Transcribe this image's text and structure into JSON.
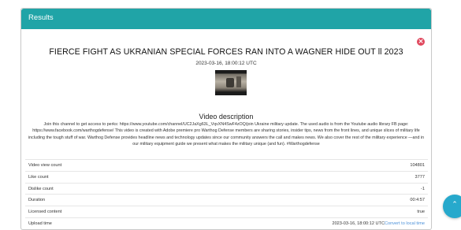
{
  "panel": {
    "header_title": "Results"
  },
  "close_button": {
    "label": "×"
  },
  "video": {
    "title": "FIERCE FIGHT AS UKRANIAN SPECIAL FORCES RAN INTO A WAGNER HIDE OUT ll 2023",
    "date": "2023-03-16, 18:00:12 UTC"
  },
  "description": {
    "heading": "Video description",
    "text": "Join this channel to get access to perks: https://www.youtube.com/channel/UC2JaXg63L_VqvXN4SwF4zOQ/join Ukraine military update. The used audio is from the Youtube audio library FB page: https://www.facebook.com/warthogdefense/ This video is created with Adobe premiere pro Warthog Defense members are sharing stories, insider tips, news from the front lines, and unique slices of military life including the tough stuff of war. Warthog Defense provides headline news and technology updates since our community answers the call and makes news. We also cover the rest of the military experience —and in our military equipment guide we present what makes the military unique (and fun). #Warthogdefense"
  },
  "stats": {
    "view_count": {
      "label": "Video view count",
      "value": "104801"
    },
    "like_count": {
      "label": "Like count",
      "value": "3777"
    },
    "dislike_count": {
      "label": "Dislike count",
      "value": "-1"
    },
    "duration": {
      "label": "Duration",
      "value": "00:4:57"
    },
    "licensed": {
      "label": "Licensed content",
      "value": "true"
    },
    "upload_time": {
      "label": "Upload time",
      "value": "2023-03-16, 18:00:12 UTC",
      "link": "Convert to local time"
    }
  },
  "fab": {
    "icon": "chevron-up-icon",
    "glyph": "⌃"
  },
  "colors": {
    "header": "#20a4a7",
    "close": "#e0475d",
    "fab": "#27a9cc",
    "link": "#4a90d9"
  }
}
